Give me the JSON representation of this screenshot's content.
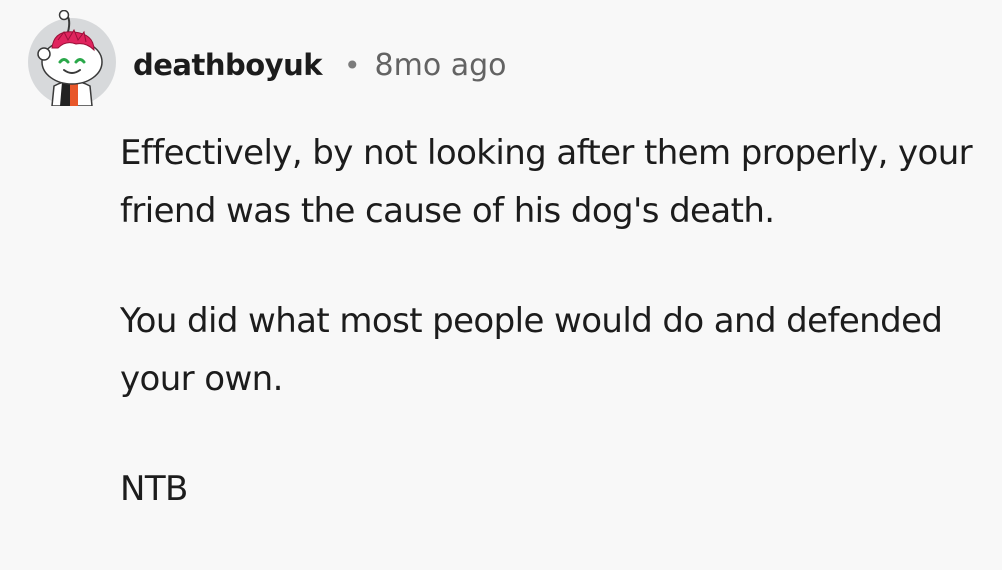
{
  "comment": {
    "author": "deathboyuk",
    "separator": "•",
    "age": "8mo ago",
    "avatar_icon": "snoo-avatar-icon",
    "paragraphs": [
      "Effectively, by not looking after them properly, your friend was the cause of his dog's death.",
      "You did what most people would do and defended your own.",
      "NTB"
    ]
  },
  "colors": {
    "background": "#f8f8f8",
    "text": "#1c1c1c",
    "muted": "#636363",
    "hair": "#e0245e"
  }
}
